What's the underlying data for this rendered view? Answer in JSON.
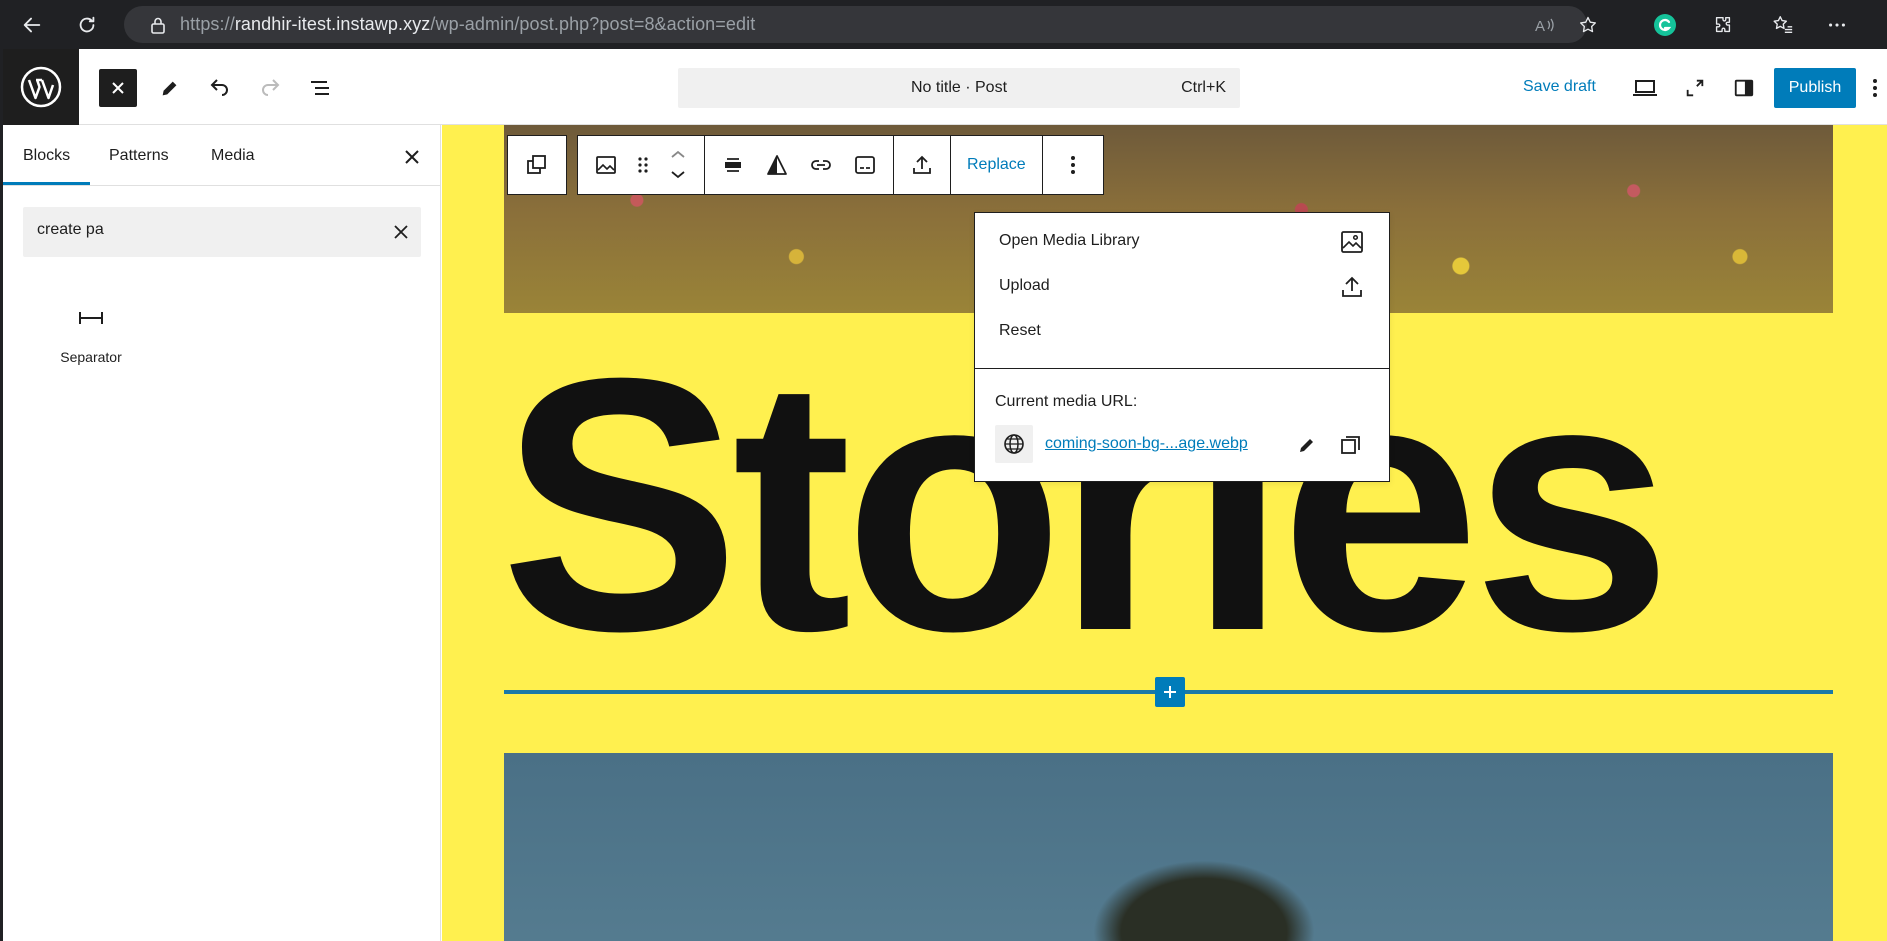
{
  "browser": {
    "url_prefix": "https://",
    "url_host": "randhir-itest.instawp.xyz",
    "url_path": "/wp-admin/post.php?post=8&action=edit"
  },
  "header": {
    "doc_title": "No title · Post",
    "shortcut": "Ctrl+K",
    "save_draft": "Save draft",
    "publish": "Publish"
  },
  "sidebar": {
    "tabs": [
      {
        "label": "Blocks"
      },
      {
        "label": "Patterns"
      },
      {
        "label": "Media"
      }
    ],
    "active_tab": "Blocks",
    "search_value": "create pa",
    "results": [
      {
        "label": "Separator",
        "icon": "separator-icon"
      }
    ]
  },
  "canvas": {
    "heading": "Stories",
    "background": "#fff04f",
    "separator_color": "#1a79a8"
  },
  "toolbar": {
    "replace_label": "Replace"
  },
  "replace_menu": {
    "items": [
      {
        "label": "Open Media Library",
        "icon": "image-icon"
      },
      {
        "label": "Upload",
        "icon": "upload-icon"
      },
      {
        "label": "Reset"
      }
    ],
    "current_url_label": "Current media URL:",
    "media_link": "coming-soon-bg-...age.webp"
  },
  "colors": {
    "accent": "#007cba",
    "dark": "#1e1e1e"
  }
}
